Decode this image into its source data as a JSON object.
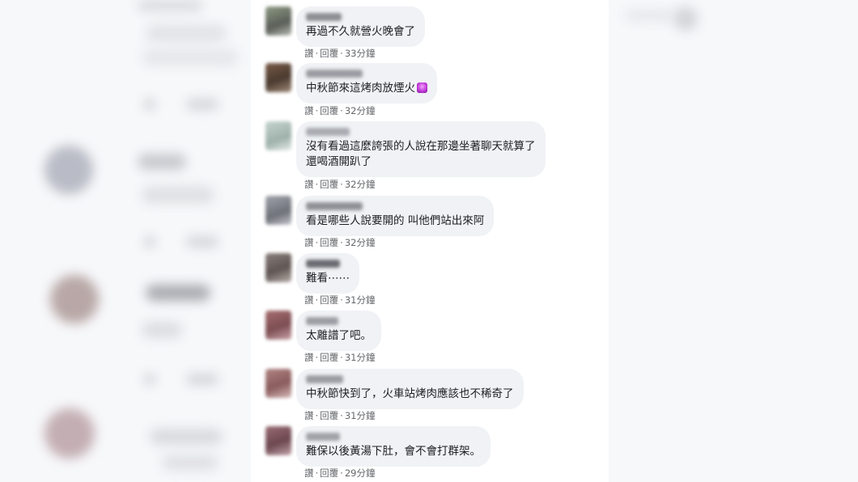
{
  "actions": {
    "like": "讚",
    "reply": "回覆",
    "dot": "·"
  },
  "comments": [
    {
      "text": "再過不久就營火晚會了",
      "time": "33分鐘"
    },
    {
      "text": "中秋節來這烤肉放煙火",
      "time": "32分鐘",
      "emoji": "purple-sparkle-emoji"
    },
    {
      "text": "沒有看過這麼誇張的人說在那邊坐著聊天就算了",
      "text2": "還喝酒開趴了",
      "time": "32分鐘"
    },
    {
      "text": "看是哪些人說要開的 叫他們站出來阿",
      "time": "32分鐘"
    },
    {
      "text": "難看⋯⋯",
      "time": "31分鐘"
    },
    {
      "text": "太離譜了吧。",
      "time": "31分鐘"
    },
    {
      "text": "中秋節快到了，火車站烤肉應該也不稀奇了",
      "time": "31分鐘"
    },
    {
      "text": "難保以後黃湯下肚，會不會打群架。",
      "time": "29分鐘"
    }
  ],
  "colors": {
    "bubble": "#f0f2f5",
    "text": "#1c1e21",
    "meta": "#65676b"
  }
}
